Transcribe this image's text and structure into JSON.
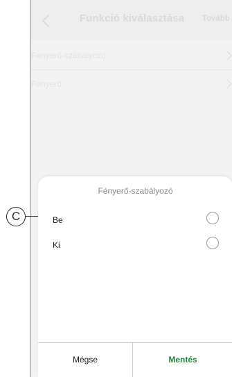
{
  "header": {
    "title": "Funkció kiválasztása",
    "next_label": "Tovább"
  },
  "list": {
    "items": [
      {
        "label": "Fényerő-szabályozó"
      },
      {
        "label": "Fényerő"
      }
    ]
  },
  "sheet": {
    "title": "Fényerő-szabályozó",
    "options": [
      {
        "label": "Be",
        "selected": false
      },
      {
        "label": "Ki",
        "selected": false
      }
    ],
    "cancel_label": "Mégse",
    "save_label": "Mentés"
  },
  "callout": {
    "label": "C"
  },
  "colors": {
    "save_text": "#1f8a3a",
    "overlay_text": "#d9d9d9"
  }
}
